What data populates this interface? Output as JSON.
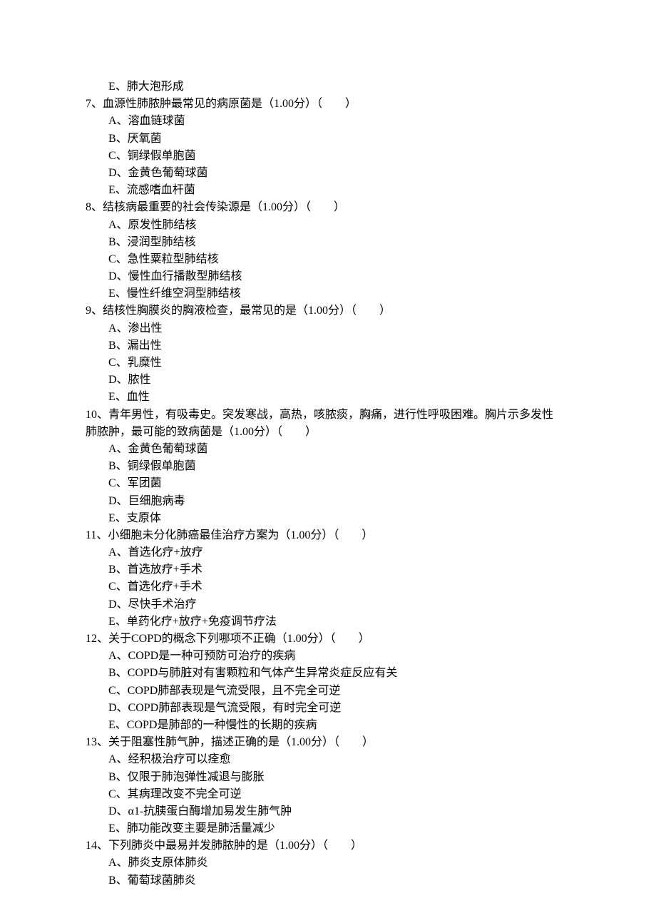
{
  "orphan_option": "E、肺大泡形成",
  "questions": [
    {
      "num": "7",
      "stem_parts": [
        "血源性肺脓肿最常见的病原菌是（1.00分）（　　）"
      ],
      "options": [
        "A、溶血链球菌",
        "B、厌氧菌",
        "C、铜绿假单胞菌",
        "D、金黄色葡萄球菌",
        "E、流感嗜血杆菌"
      ]
    },
    {
      "num": "8",
      "stem_parts": [
        "结核病最重要的社会传染源是（1.00分）（　　）"
      ],
      "options": [
        "A、原发性肺结核",
        "B、浸润型肺结核",
        "C、急性粟粒型肺结核",
        "D、慢性血行播散型肺结核",
        "E、慢性纤维空洞型肺结核"
      ]
    },
    {
      "num": "9",
      "stem_parts": [
        "结核性胸膜炎的胸液检查，最常见的是（1.00分）（　　）"
      ],
      "options": [
        "A、渗出性",
        "B、漏出性",
        "C、乳糜性",
        "D、脓性",
        "E、血性"
      ]
    },
    {
      "num": "10",
      "stem_parts": [
        "青年男性，有吸毒史。突发寒战，高热，咳脓痰，胸痛，进行性呼吸困难。胸片示多发性",
        "肺脓肿，最可能的致病菌是（1.00分）（　　）"
      ],
      "options": [
        "A、金黄色葡萄球菌",
        "B、铜绿假单胞菌",
        "C、军团菌",
        "D、巨细胞病毒",
        "E、支原体"
      ]
    },
    {
      "num": "11",
      "stem_parts": [
        "小细胞未分化肺癌最佳治疗方案为（1.00分）（　　）"
      ],
      "options": [
        "A、首选化疗+放疗",
        "B、首选放疗+手术",
        "C、首选化疗+手术",
        "D、尽快手术治疗",
        "E、单药化疗+放疗+免疫调节疗法"
      ]
    },
    {
      "num": "12",
      "stem_parts": [
        "关于COPD的概念下列哪项不正确（1.00分）（　　）"
      ],
      "options": [
        "A、COPD是一种可预防可治疗的疾病",
        "B、COPD与肺脏对有害颗粒和气体产生异常炎症反应有关",
        "C、COPD肺部表现是气流受限，且不完全可逆",
        "D、COPD肺部表现是气流受限，有时完全可逆",
        "E、COPD是肺部的一种慢性的长期的疾病"
      ]
    },
    {
      "num": "13",
      "stem_parts": [
        "关于阻塞性肺气肿，描述正确的是（1.00分）（　　）"
      ],
      "options": [
        "A、经积极治疗可以痊愈",
        "B、仅限于肺泡弹性减退与膨胀",
        "C、其病理改变不完全可逆",
        "D、α1-抗胰蛋白酶增加易发生肺气肿",
        "E、肺功能改变主要是肺活量减少"
      ]
    },
    {
      "num": "14",
      "stem_parts": [
        "下列肺炎中最易并发肺脓肿的是（1.00分）（　　）"
      ],
      "options": [
        "A、肺炎支原体肺炎",
        "B、葡萄球菌肺炎"
      ]
    }
  ]
}
